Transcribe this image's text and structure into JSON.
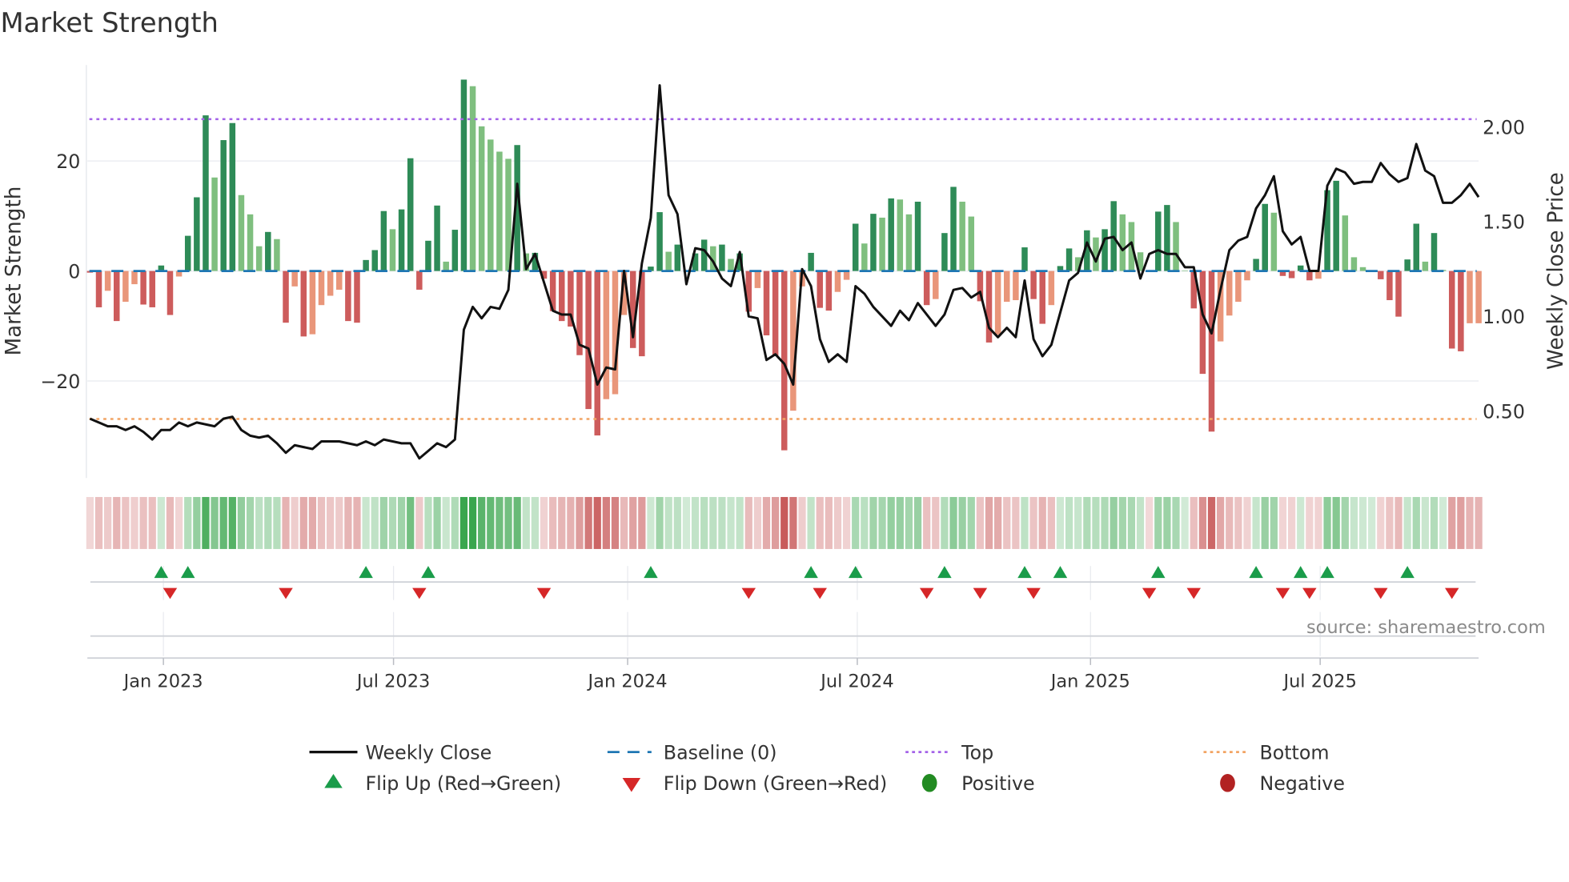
{
  "title": "Market Strength",
  "source": "source: sharemaestro.com",
  "colors": {
    "pos_rising": "#2e8b57",
    "pos_falling": "#7fbf7f",
    "neg_falling": "#cd5c5c",
    "neg_rising": "#e9967a",
    "baseline": "#1f77b4",
    "top": "#a463e8",
    "bottom": "#f2a463",
    "line": "#111111",
    "flip_up": "#1a9c4a",
    "flip_down": "#d62728",
    "positive": "#228b22",
    "negative": "#b22222"
  },
  "chart_data": {
    "type": "bar+line",
    "title": "Market Strength",
    "ylabel": "Market Strength",
    "y2label": "Weekly Close Price",
    "ylim": [
      -37,
      37
    ],
    "y2lim": [
      0.2,
      2.3
    ],
    "yticks": [
      {
        "value": 20,
        "label": "20"
      },
      {
        "value": 0,
        "label": "0"
      },
      {
        "value": -20,
        "label": "−20"
      }
    ],
    "y2ticks": [
      {
        "value": 2.0,
        "label": "2.00"
      },
      {
        "value": 1.5,
        "label": "1.50"
      },
      {
        "value": 1.0,
        "label": "1.00"
      },
      {
        "value": 0.5,
        "label": "0.50"
      }
    ],
    "xticks": [
      {
        "week": 8.25,
        "label": "Jan 2023"
      },
      {
        "week": 34.1,
        "label": "Jul 2023"
      },
      {
        "week": 60.4,
        "label": "Jan 2024"
      },
      {
        "week": 86.2,
        "label": "Jul 2024"
      },
      {
        "week": 112.4,
        "label": "Jan 2025"
      },
      {
        "week": 138.2,
        "label": "Jul 2025"
      }
    ],
    "top_level": 27.6,
    "bottom_level": -26.9,
    "baseline": 0,
    "strength": [
      -0.3,
      -6.6,
      -3.6,
      -9.1,
      -5.6,
      -2.4,
      -6.1,
      -6.6,
      1.0,
      -8.0,
      -1.0,
      6.4,
      13.4,
      28.3,
      17.0,
      23.8,
      26.9,
      13.8,
      10.3,
      4.5,
      7.1,
      5.8,
      -9.4,
      -2.8,
      -11.9,
      -11.5,
      -6.2,
      -4.5,
      -3.4,
      -9.1,
      -9.4,
      2.0,
      3.8,
      10.9,
      7.6,
      11.2,
      20.5,
      -3.4,
      5.5,
      11.9,
      1.7,
      7.5,
      34.8,
      33.6,
      26.3,
      23.9,
      21.7,
      20.4,
      22.9,
      3.2,
      3.3,
      -1.4,
      -7.3,
      -9.1,
      -10.1,
      -15.3,
      -25.1,
      -29.9,
      -23.3,
      -22.4,
      -8.0,
      -14.0,
      -15.5,
      0.8,
      10.7,
      3.5,
      4.8,
      0,
      3.2,
      5.7,
      4.5,
      4.8,
      2.2,
      3.2,
      -7.4,
      -3.1,
      -11.7,
      -15.4,
      -32.6,
      -25.4,
      -2.8,
      3.3,
      -6.7,
      -7.2,
      -3.8,
      -1.6,
      8.6,
      5.0,
      10.4,
      9.7,
      13.2,
      13.0,
      10.3,
      12.6,
      -6.2,
      -5.1,
      6.9,
      15.3,
      12.6,
      9.9,
      -5.5,
      -13.0,
      -11.6,
      -5.6,
      -5.3,
      4.3,
      -5.1,
      -9.6,
      -6.2,
      0.9,
      4.1,
      2.5,
      7.4,
      6.1,
      7.6,
      12.7,
      10.3,
      8.9,
      3.4,
      -0.2,
      10.8,
      12.0,
      8.9,
      0.1,
      -6.8,
      -18.7,
      -29.2,
      -12.8,
      -8.1,
      -5.6,
      -1.7,
      2.2,
      12.2,
      10.6,
      -0.9,
      -1.3,
      1.0,
      -1.7,
      -1.4,
      14.7,
      16.4,
      10.1,
      2.5,
      0.7,
      0,
      -1.5,
      -5.3,
      -8.3,
      2.1,
      8.6,
      1.7,
      6.9,
      0.2,
      -14.1,
      -14.6,
      -9.5,
      -9.5
    ],
    "weekly_close": [
      0.46,
      0.44,
      0.42,
      0.42,
      0.4,
      0.42,
      0.39,
      0.35,
      0.4,
      0.4,
      0.44,
      0.42,
      0.44,
      0.43,
      0.42,
      0.46,
      0.47,
      0.4,
      0.37,
      0.36,
      0.37,
      0.33,
      0.28,
      0.32,
      0.31,
      0.3,
      0.34,
      0.34,
      0.34,
      0.33,
      0.32,
      0.34,
      0.32,
      0.35,
      0.34,
      0.33,
      0.33,
      0.25,
      0.29,
      0.33,
      0.31,
      0.35,
      0.93,
      1.05,
      0.99,
      1.05,
      1.04,
      1.14,
      1.7,
      1.25,
      1.33,
      1.18,
      1.03,
      1.01,
      1.01,
      0.85,
      0.83,
      0.64,
      0.73,
      0.72,
      1.24,
      0.89,
      1.28,
      1.52,
      2.22,
      1.64,
      1.54,
      1.17,
      1.36,
      1.35,
      1.29,
      1.2,
      1.16,
      1.34,
      1.0,
      0.99,
      0.77,
      0.8,
      0.75,
      0.64,
      1.25,
      1.16,
      0.88,
      0.76,
      0.8,
      0.76,
      1.16,
      1.12,
      1.05,
      1.0,
      0.95,
      1.03,
      0.98,
      1.07,
      1.01,
      0.95,
      1.01,
      1.14,
      1.15,
      1.1,
      1.13,
      0.94,
      0.89,
      0.94,
      0.89,
      1.19,
      0.88,
      0.79,
      0.85,
      1.02,
      1.19,
      1.23,
      1.39,
      1.29,
      1.41,
      1.42,
      1.35,
      1.39,
      1.2,
      1.33,
      1.35,
      1.33,
      1.33,
      1.26,
      1.26,
      1.01,
      0.91,
      1.14,
      1.35,
      1.4,
      1.42,
      1.57,
      1.64,
      1.74,
      1.45,
      1.38,
      1.42,
      1.24,
      1.24,
      1.69,
      1.78,
      1.76,
      1.7,
      1.71,
      1.71,
      1.81,
      1.75,
      1.71,
      1.73,
      1.91,
      1.77,
      1.74,
      1.6,
      1.6,
      1.64,
      1.7,
      1.63
    ],
    "legend": {
      "placement": "bottom-center",
      "entries": [
        {
          "label": "Weekly Close",
          "marker": "line"
        },
        {
          "label": "Baseline (0)",
          "marker": "dashed"
        },
        {
          "label": "Top",
          "marker": "dotted-purple"
        },
        {
          "label": "Bottom",
          "marker": "dotted-orange"
        },
        {
          "label": "Flip Up (Red→Green)",
          "marker": "triangle-up"
        },
        {
          "label": "Flip Down (Green→Red)",
          "marker": "triangle-down"
        },
        {
          "label": "Positive",
          "marker": "dot-green"
        },
        {
          "label": "Negative",
          "marker": "dot-red"
        }
      ]
    }
  }
}
